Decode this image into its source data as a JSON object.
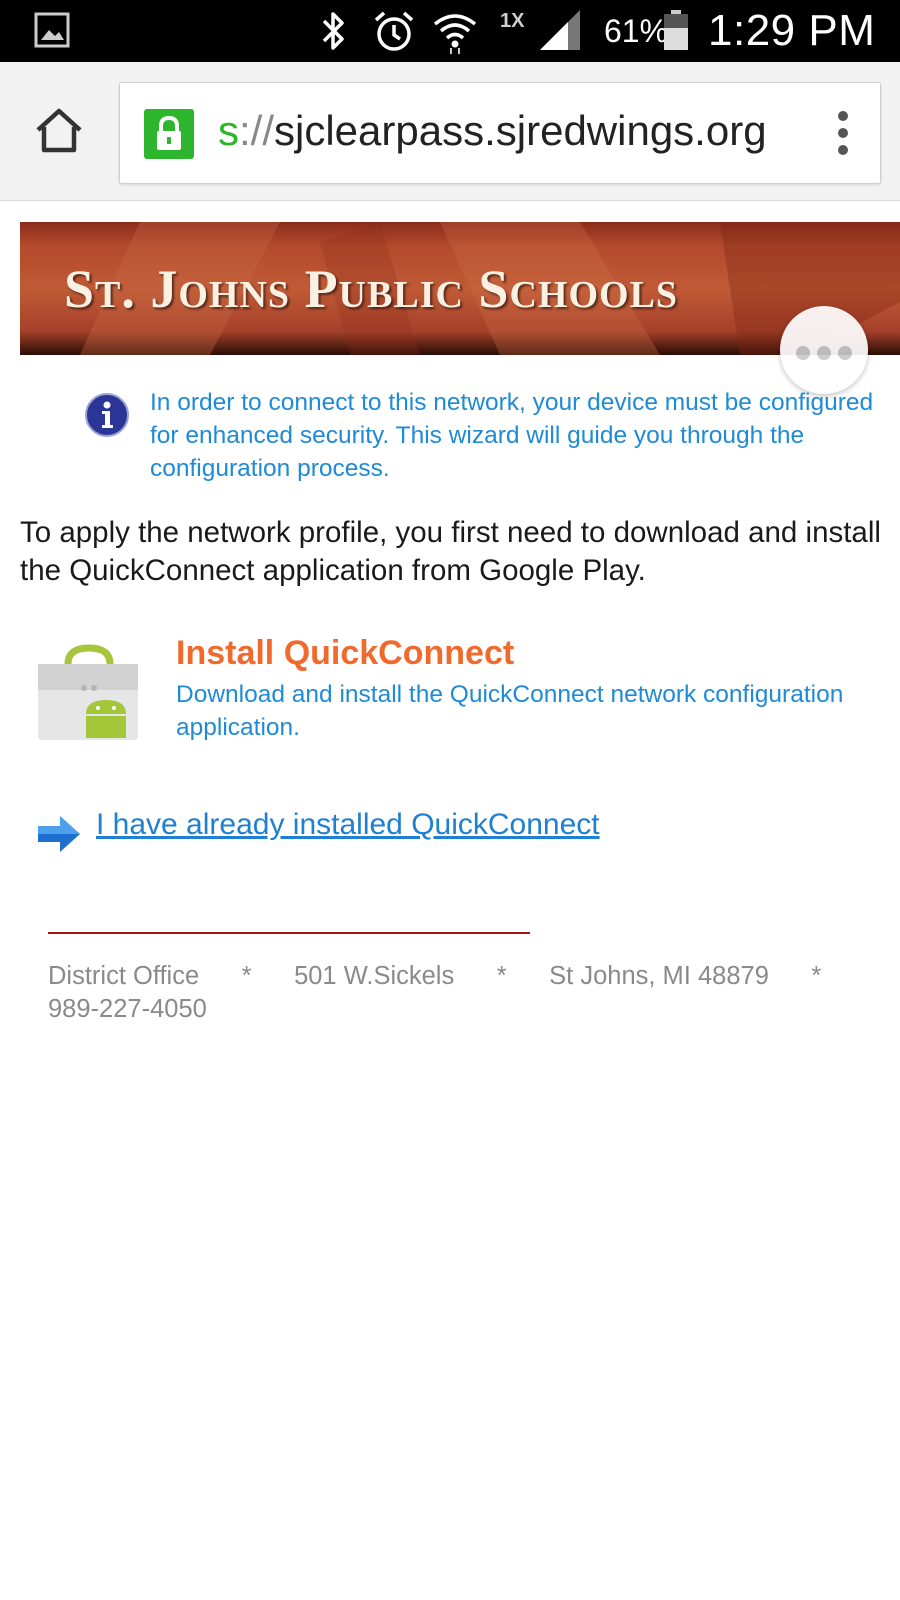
{
  "status_bar": {
    "network_type": "1X",
    "battery_percent": "61%",
    "time": "1:29 PM",
    "icons": [
      "gallery-notification-icon",
      "bluetooth-icon",
      "alarm-icon",
      "wifi-icon",
      "cell-signal-icon",
      "battery-icon"
    ]
  },
  "browser": {
    "url_scheme": "s",
    "url_separator": "://",
    "url_host": "sjclearpass.sjredwings.org",
    "icons": [
      "home-icon",
      "lock-icon",
      "overflow-menu-icon"
    ]
  },
  "banner": {
    "title": "St. Johns Public Schools"
  },
  "notice": {
    "text": "In order to connect to this network, your device must be configured for enhanced security. This wizard will guide you through the configuration process."
  },
  "intro": {
    "text": "To apply the network profile, you first need to download and install the QuickConnect application from Google Play."
  },
  "install": {
    "title": "Install QuickConnect",
    "description": "Download and install the QuickConnect network configuration application."
  },
  "already_installed": {
    "label": "I have already installed QuickConnect"
  },
  "footer": {
    "text": "District Office      *      501 W.Sickels      *      St Johns, MI 48879      *      989-227-4050"
  },
  "colors": {
    "link_blue": "#1f8ad6",
    "install_orange": "#f06a2e",
    "divider_red": "#a3161c",
    "lock_green": "#2db52d"
  }
}
